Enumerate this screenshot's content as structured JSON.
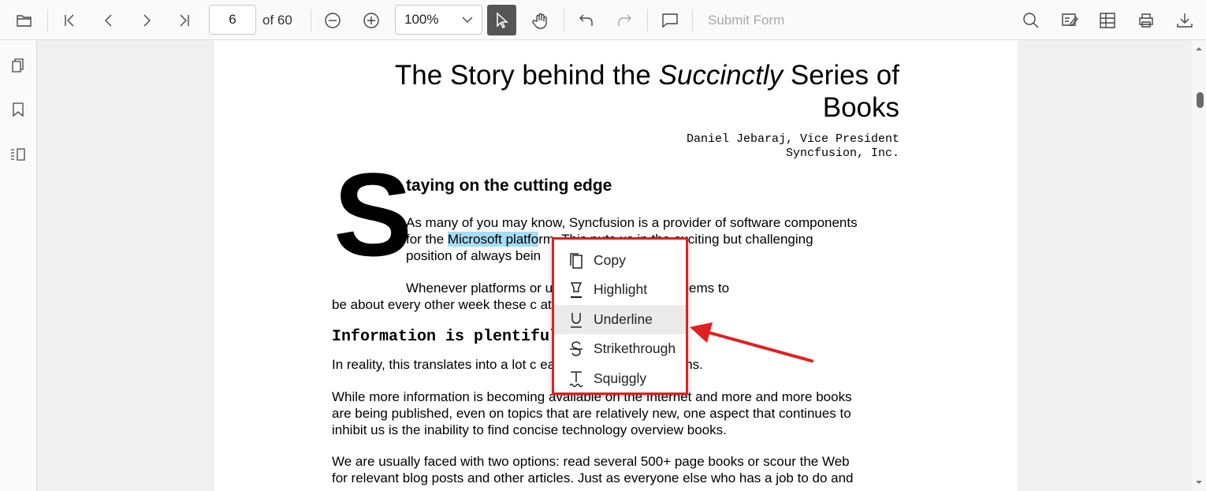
{
  "toolbar": {
    "page_number": "6",
    "page_total": "of 60",
    "zoom": "100%",
    "submit_form": "Submit Form"
  },
  "document": {
    "title_part1": "The Story behind the ",
    "title_italic": "Succinctly",
    "title_part2": " Series of",
    "title_line2": "Books",
    "author_line1": "Daniel Jebaraj, Vice President",
    "author_line2": "Syncfusion, Inc.",
    "dropcap": "S",
    "heading1": "taying on the cutting edge",
    "p1_line1": "As many of you may know, Syncfusion is a provider of software components",
    "p1_line2_pre": "for the ",
    "p1_line2_hl": "Microsoft platfo",
    "p1_line2_post": "rm. This puts us in the exciting but challenging",
    "p1_line3": "position of always bein",
    "p2_line1": "Whenever platforms or                  ut of Microsoft, which seems to",
    "p2_line2": "be about every other week these c                          ate ourselves, quickly.",
    "heading2": "Information is plentiful b                      gest",
    "p3_line1": "In reality, this translates into a lot c                         earches, and Twitter scans.",
    "p4_line1": "While more information is becoming available on the Internet and more and more books",
    "p4_line2": "are being published, even on topics that are relatively new, one aspect that continues to",
    "p4_line3": "inhibit us is the inability to find concise technology overview books.",
    "p5_line1": "We are usually faced with two options: read several 500+ page books or scour the Web",
    "p5_line2": "for relevant blog posts and other articles. Just as everyone else who has a job to do and"
  },
  "context_menu": {
    "items": [
      {
        "label": "Copy",
        "icon": "copy-icon"
      },
      {
        "label": "Highlight",
        "icon": "highlight-icon"
      },
      {
        "label": "Underline",
        "icon": "underline-icon"
      },
      {
        "label": "Strikethrough",
        "icon": "strikethrough-icon"
      },
      {
        "label": "Squiggly",
        "icon": "squiggly-icon"
      }
    ],
    "active_item": "Underline"
  },
  "colors": {
    "selection_highlight": "#a6dcf5",
    "callout_red": "#e02020",
    "active_tool": "#555555"
  }
}
